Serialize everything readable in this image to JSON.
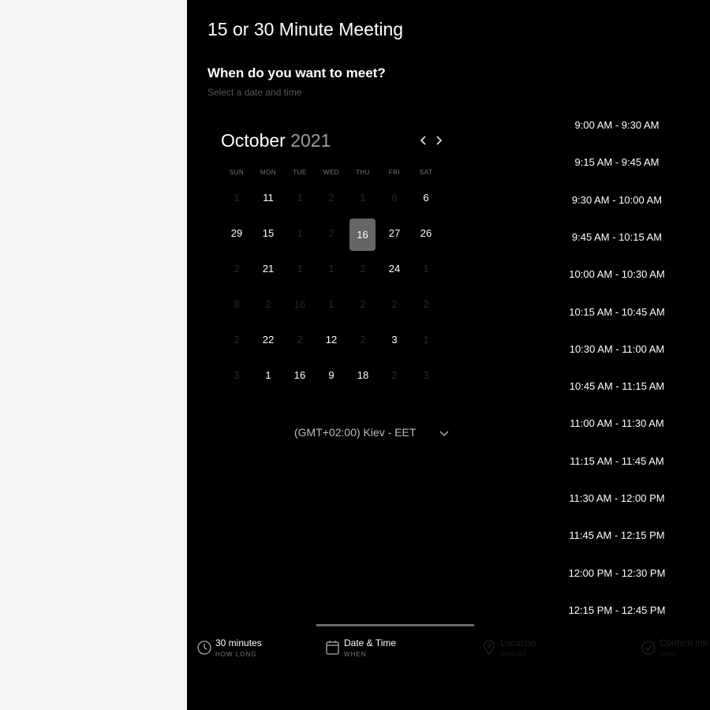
{
  "header": {
    "title": "15 or 30 Minute Meeting",
    "question": "When do you want to meet?",
    "subtitle": "Select a date and time"
  },
  "calendar": {
    "month": "October",
    "year": "2021",
    "prev_icon": "chevron-left-icon",
    "next_icon": "chevron-right-icon",
    "weekdays": [
      "SUN",
      "MON",
      "TUE",
      "WED",
      "THU",
      "FRI",
      "SAT"
    ],
    "rows": [
      [
        "1",
        "11",
        "1",
        "2",
        "1",
        "6",
        "6"
      ],
      [
        "29",
        "15",
        "1",
        "2",
        "16",
        "27",
        "26"
      ],
      [
        "2",
        "21",
        "1",
        "1",
        "2",
        "24",
        "1"
      ],
      [
        "8",
        "2",
        "16",
        "1",
        "2",
        "2",
        "2"
      ],
      [
        "2",
        "22",
        "2",
        "12",
        "2",
        "3",
        "1"
      ],
      [
        "3",
        "1",
        "16",
        "9",
        "18",
        "2",
        "3"
      ]
    ],
    "enabled": [
      [
        false,
        true,
        false,
        false,
        false,
        false,
        true
      ],
      [
        true,
        true,
        false,
        false,
        true,
        true,
        true
      ],
      [
        false,
        true,
        false,
        false,
        false,
        true,
        false
      ],
      [
        false,
        false,
        false,
        false,
        false,
        false,
        false
      ],
      [
        false,
        true,
        false,
        true,
        false,
        true,
        false
      ],
      [
        false,
        true,
        true,
        true,
        true,
        false,
        false
      ]
    ],
    "selected": "16"
  },
  "timezone": {
    "label": "(GMT+02:00) Kiev - EET",
    "icon": "chevron-down-icon"
  },
  "slots": [
    "9:00 AM - 9:30 AM",
    "9:15 AM - 9:45 AM",
    "9:30 AM - 10:00 AM",
    "9:45 AM - 10:15 AM",
    "10:00 AM - 10:30 AM",
    "10:15 AM - 10:45 AM",
    "10:30 AM - 11:00 AM",
    "10:45 AM - 11:15 AM",
    "11:00 AM - 11:30 AM",
    "11:15 AM - 11:45 AM",
    "11:30 AM - 12:00 PM",
    "11:45 AM - 12:15 PM",
    "12:00 PM - 12:30 PM",
    "12:15 PM - 12:45 PM"
  ],
  "steps": [
    {
      "label": "30 minutes",
      "sub": "HOW LONG",
      "icon": "clock-icon"
    },
    {
      "label": "Date & Time",
      "sub": "WHEN",
      "icon": "calendar-icon"
    },
    {
      "label": "Location",
      "sub": "WHERE",
      "icon": "location-pin-icon"
    },
    {
      "label": "Confirm info",
      "sub": "WHO",
      "icon": "check-icon"
    }
  ],
  "colors": {
    "panel_bg": "#000000",
    "side_bg": "#f4f4f4",
    "selected_day_bg": "#666666",
    "progress_bar": "#6a6a6a"
  }
}
